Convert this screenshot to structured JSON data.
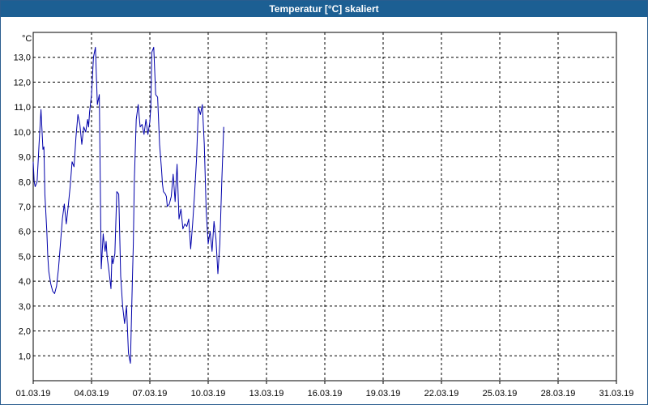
{
  "window": {
    "title": "Temperatur [°C] skaliert"
  },
  "chart_data": {
    "type": "line",
    "title": "Temperatur [°C] skaliert",
    "ylabel": "°C",
    "xlabel": "",
    "ylim": [
      0,
      14
    ],
    "xlim": [
      1,
      31
    ],
    "grid": true,
    "ytick_values": [
      1,
      2,
      3,
      4,
      5,
      6,
      7,
      8,
      9,
      10,
      11,
      12,
      13
    ],
    "ytick_labels": [
      "1,0",
      "2,0",
      "3,0",
      "4,0",
      "5,0",
      "6,0",
      "7,0",
      "8,0",
      "9,0",
      "10,0",
      "11,0",
      "12,0",
      "13,0"
    ],
    "xtick_values": [
      1,
      4,
      7,
      10,
      13,
      16,
      19,
      22,
      25,
      28,
      31
    ],
    "xtick_labels": [
      "01.03.19",
      "04.03.19",
      "07.03.19",
      "10.03.19",
      "13.03.19",
      "16.03.19",
      "19.03.19",
      "22.03.19",
      "25.03.19",
      "28.03.19",
      "31.03.19"
    ],
    "series": [
      {
        "color": "#0000aa",
        "x": [
          1.0,
          1.05,
          1.1,
          1.2,
          1.3,
          1.4,
          1.5,
          1.55,
          1.6,
          1.7,
          1.75,
          1.8,
          1.9,
          2.0,
          2.1,
          2.2,
          2.3,
          2.4,
          2.5,
          2.6,
          2.7,
          2.8,
          2.9,
          3.0,
          3.1,
          3.2,
          3.3,
          3.4,
          3.5,
          3.6,
          3.7,
          3.8,
          3.85,
          3.9,
          4.0,
          4.1,
          4.2,
          4.3,
          4.4,
          4.5,
          4.6,
          4.65,
          4.7,
          4.75,
          4.8,
          4.9,
          5.0,
          5.05,
          5.1,
          5.2,
          5.3,
          5.4,
          5.5,
          5.6,
          5.7,
          5.8,
          5.9,
          6.0,
          6.1,
          6.15,
          6.2,
          6.3,
          6.4,
          6.5,
          6.6,
          6.7,
          6.8,
          6.9,
          7.0,
          7.05,
          7.1,
          7.2,
          7.3,
          7.4,
          7.5,
          7.6,
          7.65,
          7.7,
          7.8,
          7.85,
          7.9,
          8.0,
          8.1,
          8.2,
          8.3,
          8.4,
          8.5,
          8.6,
          8.7,
          8.8,
          8.9,
          9.0,
          9.1,
          9.2,
          9.3,
          9.4,
          9.5,
          9.6,
          9.7,
          9.8,
          9.9,
          10.0,
          10.1,
          10.2,
          10.3,
          10.4,
          10.5,
          10.6,
          10.7,
          10.8
        ],
        "y": [
          8.8,
          8.0,
          7.8,
          8.0,
          9.5,
          10.9,
          9.3,
          9.4,
          7.5,
          6.0,
          5.0,
          4.4,
          3.9,
          3.6,
          3.5,
          3.8,
          4.5,
          5.5,
          6.5,
          7.1,
          6.3,
          7.0,
          7.8,
          8.8,
          8.6,
          9.8,
          10.7,
          10.3,
          9.5,
          10.2,
          10.0,
          10.5,
          10.2,
          10.8,
          11.5,
          13.0,
          13.4,
          11.1,
          11.5,
          4.5,
          5.9,
          5.5,
          5.2,
          5.6,
          5.0,
          4.4,
          3.7,
          5.0,
          4.7,
          5.1,
          7.6,
          7.5,
          4.2,
          3.0,
          2.3,
          3.0,
          1.1,
          0.7,
          4.0,
          5.5,
          8.0,
          10.5,
          11.1,
          10.2,
          10.3,
          9.9,
          10.5,
          9.9,
          10.4,
          11.0,
          13.2,
          13.4,
          11.5,
          11.4,
          9.5,
          8.5,
          7.9,
          7.6,
          7.5,
          7.4,
          7.0,
          7.1,
          7.4,
          8.3,
          7.2,
          8.7,
          6.5,
          6.9,
          6.1,
          6.3,
          6.2,
          6.5,
          5.3,
          6.3,
          7.5,
          8.9,
          11.0,
          10.7,
          11.1,
          9.5,
          6.8,
          5.5,
          6.0,
          5.2,
          6.4,
          5.7,
          4.3,
          5.5,
          8.0,
          10.2
        ]
      }
    ]
  }
}
